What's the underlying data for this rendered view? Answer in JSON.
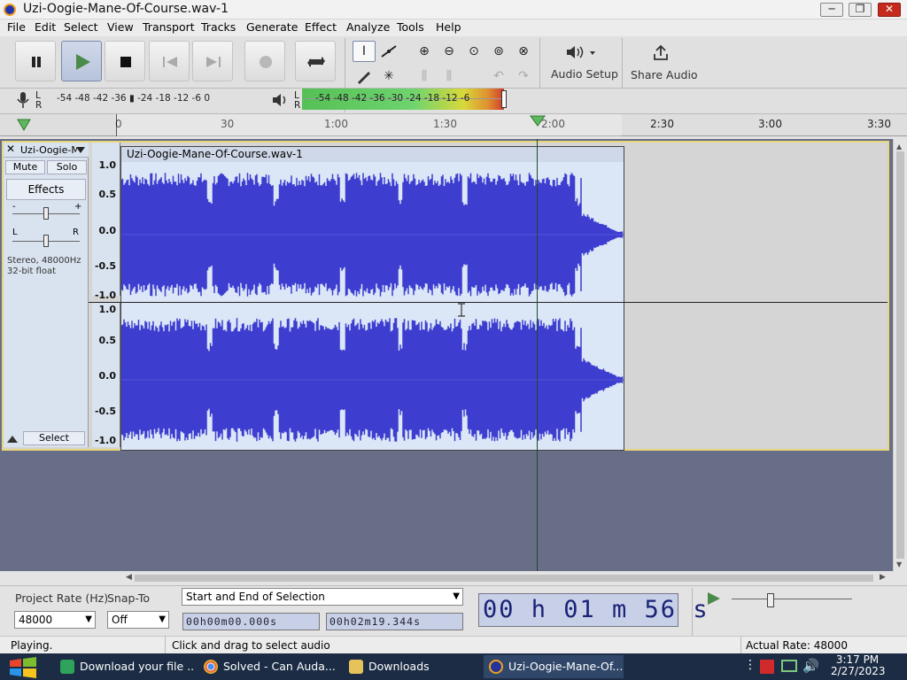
{
  "window": {
    "title": "Uzi-Oogie-Mane-Of-Course.wav-1",
    "minimize": "─",
    "maximize": "❐",
    "close": "✕"
  },
  "menu": [
    "File",
    "Edit",
    "Select",
    "View",
    "Transport",
    "Tracks",
    "Generate",
    "Effect",
    "Analyze",
    "Tools",
    "Help"
  ],
  "toolbar": {
    "audio_setup_label": "Audio Setup",
    "share_audio_label": "Share Audio",
    "record_meter_scale": "-54 -48 -42 -36 ▮ -24 -18 -12 -6 0",
    "play_meter_scale": "-54 -48 -42 -36 -30 -24 -18 -12 -6",
    "meter_lr": {
      "l": "L",
      "r": "R"
    }
  },
  "ruler": {
    "ticks": [
      "0",
      "30",
      "1:00",
      "1:30",
      "2:00",
      "2:30",
      "3:00",
      "3:30"
    ],
    "playhead_time": "1:56"
  },
  "track": {
    "name": "Uzi-Oogie-M",
    "mute_label": "Mute",
    "solo_label": "Solo",
    "effects_label": "Effects",
    "gain_minus": "-",
    "gain_plus": "+",
    "pan_left": "L",
    "pan_right": "R",
    "info_line1": "Stereo, 48000Hz",
    "info_line2": "32-bit float",
    "select_label": "Select",
    "clip_name": "Uzi-Oogie-Mane-Of-Course.wav-1",
    "scale_top": [
      "1.0",
      "0.5",
      "0.0",
      "-0.5",
      "-1.0"
    ],
    "scale_bottom": [
      "1.0",
      "0.5",
      "0.0",
      "-0.5",
      "-1.0"
    ],
    "waveform_color": "#3d3dd0"
  },
  "bottom": {
    "project_rate_label": "Project Rate (Hz)",
    "project_rate_value": "48000",
    "snap_to_label": "Snap-To",
    "snap_to_value": "Off",
    "selection_mode": "Start and End of Selection",
    "selection_start": "00h00m00.000s",
    "selection_end": "00h02m19.344s",
    "big_time": "00 h 01 m 56 s"
  },
  "status": {
    "left": "Playing.",
    "hint": "Click and drag to select audio",
    "rate": "Actual Rate: 48000"
  },
  "taskbar": {
    "tasks": [
      "Download your file ...",
      "Solved - Can Auda...",
      "Downloads",
      "Uzi-Oogie-Mane-Of..."
    ],
    "time": "3:17 PM",
    "date": "2/27/2023"
  },
  "colors": {
    "accent": "#3d3dd0",
    "track_border": "#e6d67c",
    "background_empty": "#686d88"
  }
}
